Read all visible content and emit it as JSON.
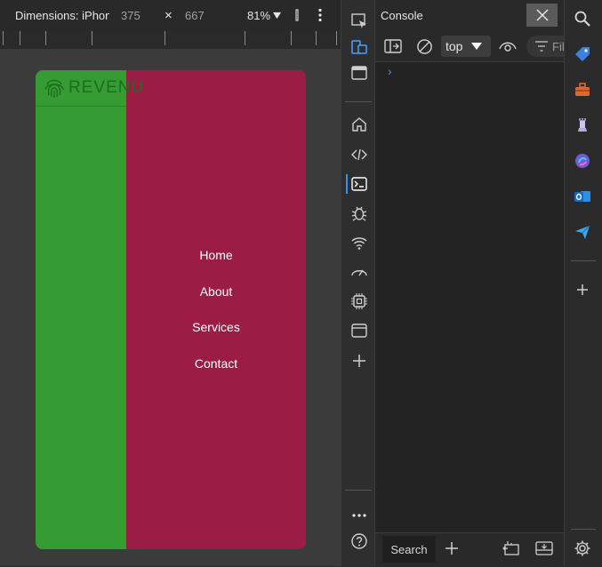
{
  "device_toolbar": {
    "device_name": "Dimensions: iPhone SE",
    "width": "375",
    "times": "×",
    "height": "667",
    "zoom": "81%"
  },
  "page": {
    "nav": [
      "Home",
      "About",
      "Services",
      "Contact"
    ],
    "logo_text": "REVENU",
    "colors": {
      "green": "#349c33",
      "crimson": "#9b1d45"
    }
  },
  "console": {
    "title": "Console",
    "context": "top",
    "filter_placeholder": "Filter",
    "prompt": "›"
  },
  "drawer": {
    "search_tab": "Search"
  },
  "icons": {
    "tool_strip": [
      "inspect-icon",
      "device-toggle-icon",
      "dock-icon",
      "home-icon",
      "elements-icon",
      "console-icon",
      "sources-bug-icon",
      "network-wifi-icon",
      "performance-icon",
      "memory-chip-icon",
      "application-icon",
      "more-tools-plus-icon",
      "more-icon",
      "help-icon"
    ],
    "edge_sidebar": [
      "search-icon",
      "tag-icon",
      "toolbox-icon",
      "chess-icon",
      "copilot-icon",
      "outlook-icon",
      "send-icon",
      "add-icon",
      "settings-icon"
    ]
  }
}
